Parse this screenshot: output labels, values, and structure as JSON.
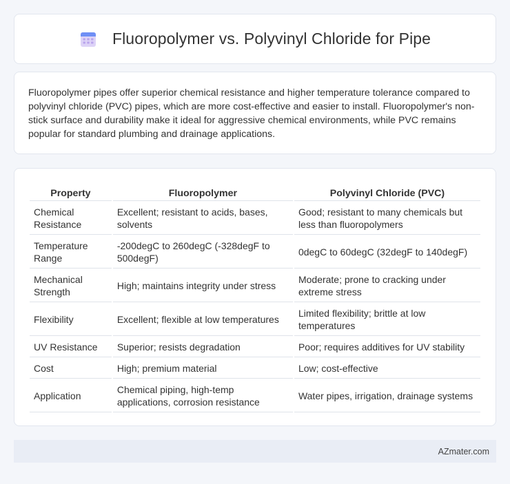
{
  "header": {
    "title": "Fluoropolymer vs. Polyvinyl Chloride for Pipe",
    "icon": "calendar-grid-icon"
  },
  "summary": {
    "text": "Fluoropolymer pipes offer superior chemical resistance and higher temperature tolerance compared to polyvinyl chloride (PVC) pipes, which are more cost-effective and easier to install. Fluoropolymer's non-stick surface and durability make it ideal for aggressive chemical environments, while PVC remains popular for standard plumbing and drainage applications."
  },
  "table": {
    "headers": [
      "Property",
      "Fluoropolymer",
      "Polyvinyl Chloride (PVC)"
    ],
    "rows": [
      [
        "Chemical Resistance",
        "Excellent; resistant to acids, bases, solvents",
        "Good; resistant to many chemicals but less than fluoropolymers"
      ],
      [
        "Temperature Range",
        "-200degC to 260degC (-328degF to 500degF)",
        "0degC to 60degC (32degF to 140degF)"
      ],
      [
        "Mechanical Strength",
        "High; maintains integrity under stress",
        "Moderate; prone to cracking under extreme stress"
      ],
      [
        "Flexibility",
        "Excellent; flexible at low temperatures",
        "Limited flexibility; brittle at low temperatures"
      ],
      [
        "UV Resistance",
        "Superior; resists degradation",
        "Poor; requires additives for UV stability"
      ],
      [
        "Cost",
        "High; premium material",
        "Low; cost-effective"
      ],
      [
        "Application",
        "Chemical piping, high-temp applications, corrosion resistance",
        "Water pipes, irrigation, drainage systems"
      ]
    ]
  },
  "footer": {
    "brand": "AZmater.com"
  },
  "colors": {
    "background": "#f4f6fa",
    "card": "#ffffff",
    "footer": "#e9edf5",
    "icon_top": "#6c8cf5",
    "icon_body": "#c9b8f0"
  }
}
